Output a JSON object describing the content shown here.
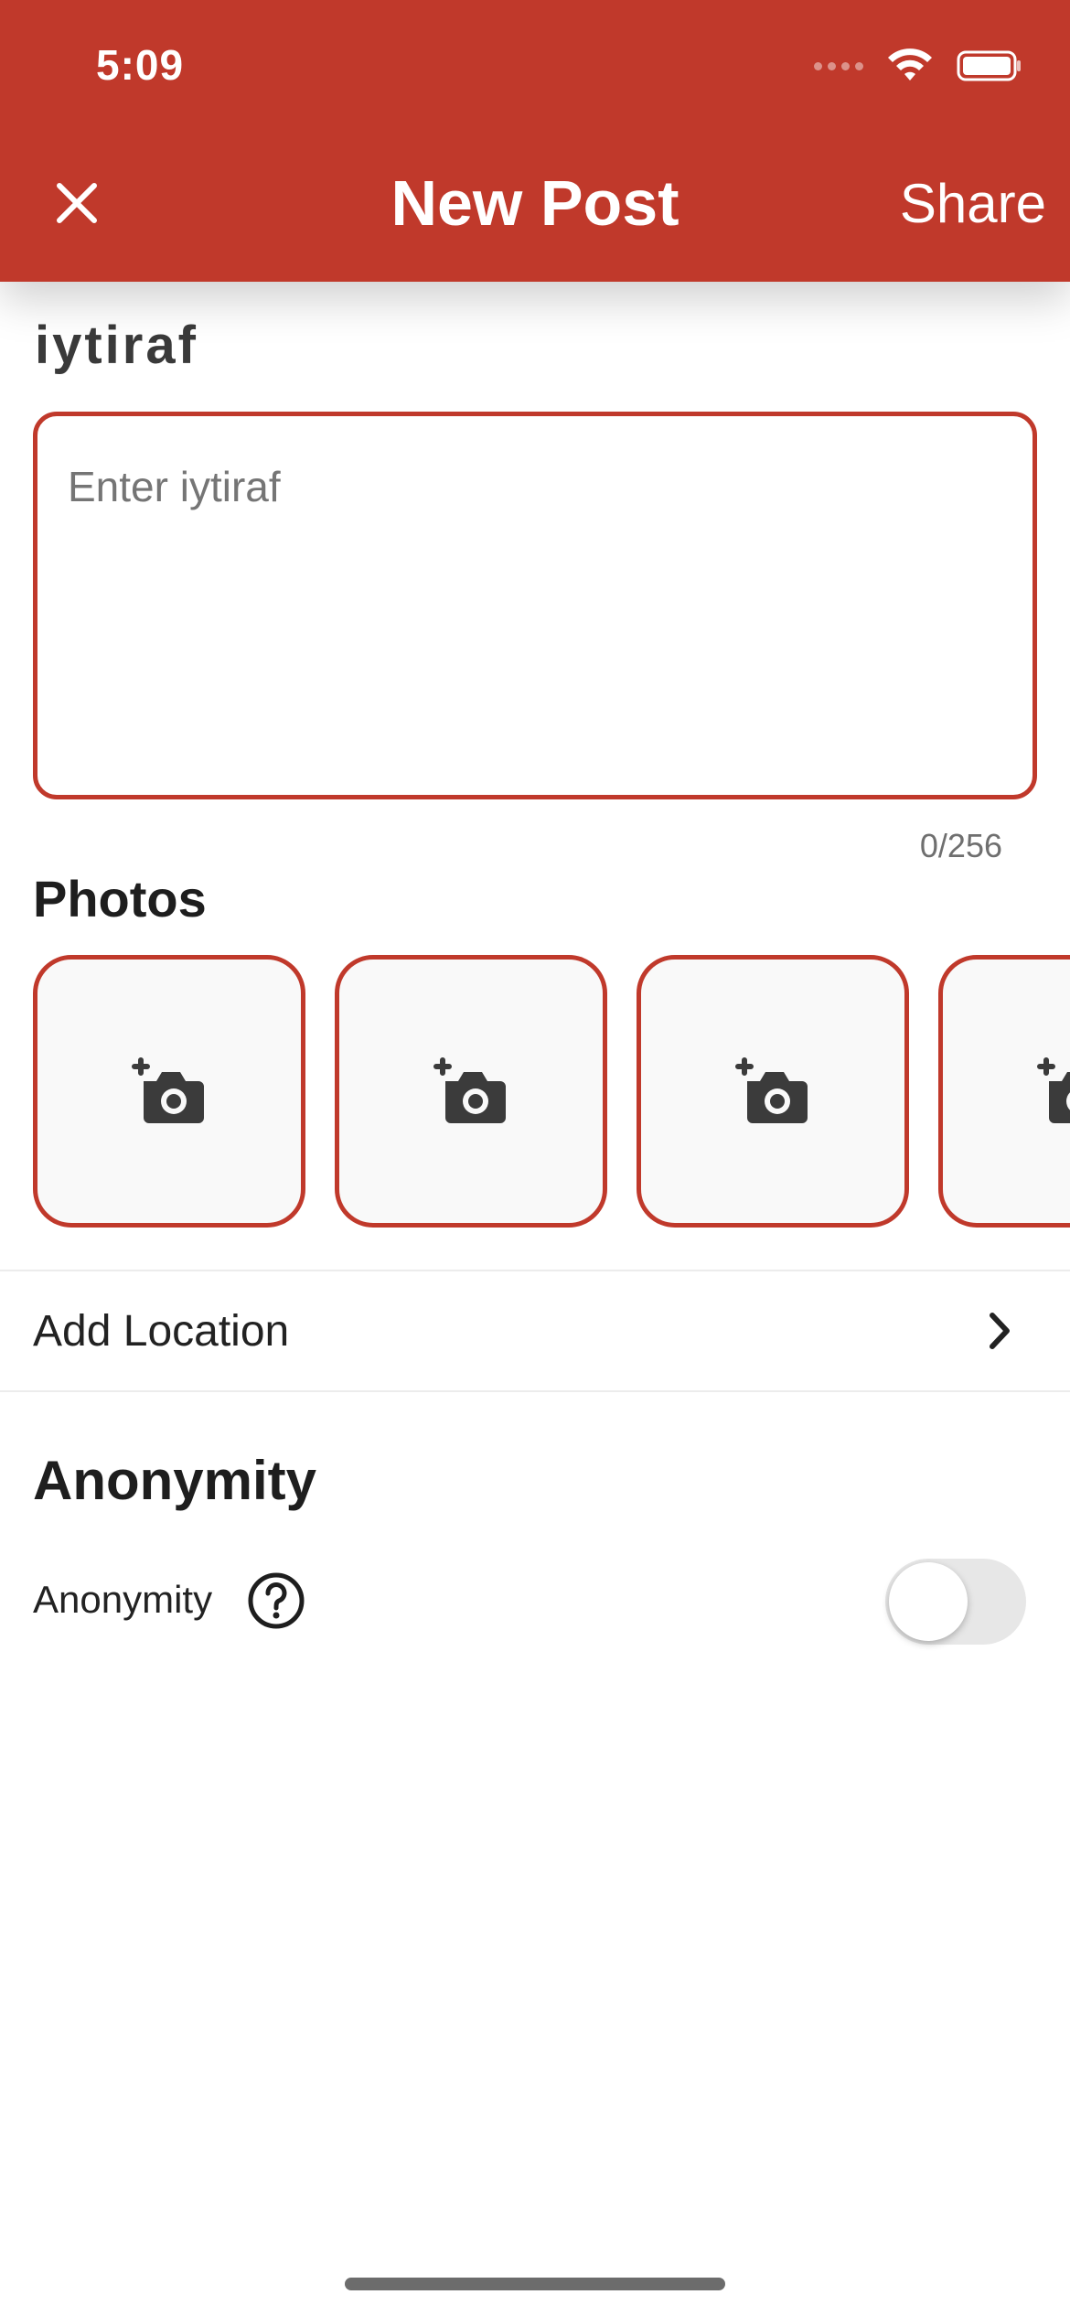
{
  "status_bar": {
    "time": "5:09"
  },
  "header": {
    "title": "New Post",
    "share_label": "Share",
    "close_icon": "close-icon"
  },
  "form": {
    "section_label": "iytiraf",
    "text_placeholder": "Enter iytiraf",
    "text_value": "",
    "char_count": "0/256"
  },
  "photos": {
    "title": "Photos",
    "slots": [
      {
        "icon": "add-photo-icon"
      },
      {
        "icon": "add-photo-icon"
      },
      {
        "icon": "add-photo-icon"
      },
      {
        "icon": "add-photo-icon"
      }
    ]
  },
  "location": {
    "label": "Add Location",
    "icon": "chevron-right-icon"
  },
  "anonymity": {
    "title": "Anonymity",
    "label": "Anonymity",
    "help_icon": "help-circle-icon",
    "enabled": false
  },
  "colors": {
    "accent": "#c0392b",
    "background": "#ffffff",
    "toggle_off": "#e7e7e7"
  }
}
